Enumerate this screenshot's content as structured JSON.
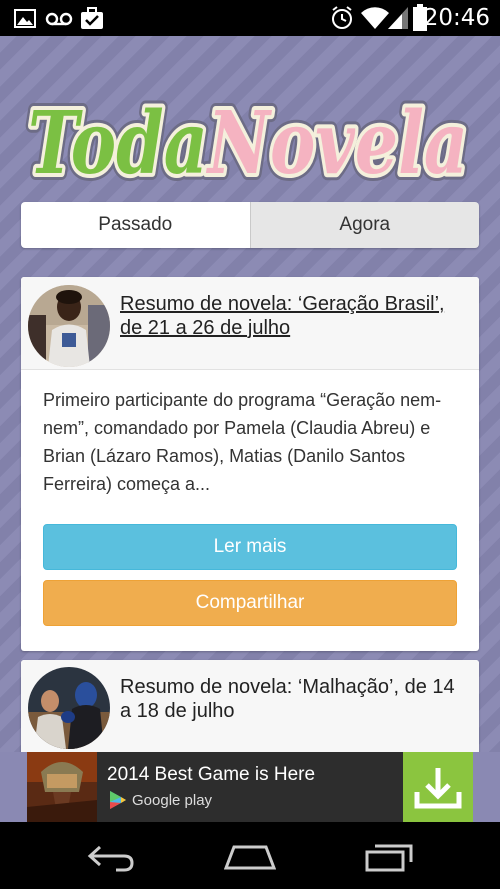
{
  "status_bar": {
    "time": "20:46",
    "icons": [
      "image-icon",
      "voicemail-icon",
      "briefcase-check-icon",
      "alarm-icon",
      "wifi-icon",
      "signal-icon",
      "battery-icon"
    ]
  },
  "logo": {
    "part1": "Toda",
    "part2": "Novela",
    "color1": "#7bc043",
    "color2": "#f7b6c2"
  },
  "tabs": [
    {
      "label": "Passado",
      "active": true
    },
    {
      "label": "Agora",
      "active": false
    }
  ],
  "cards": [
    {
      "title": "Resumo de novela: ‘Geração Brasil’, de 21 a 26 de julho",
      "excerpt": "Primeiro participante do programa “Geração nem-nem”, comandado por Pamela (Claudia Abreu) e Brian (Lázaro Ramos), Matias (Danilo Santos Ferreira) começa a...",
      "read_label": "Ler mais",
      "share_label": "Compartilhar"
    },
    {
      "title": "Resumo de novela: ‘Malhação’, de 14 a 18 de julho"
    }
  ],
  "ad": {
    "title": "2014 Best Game is Here",
    "store": "Google play",
    "accent": "#8bc53f"
  },
  "nav": [
    "back-icon",
    "home-icon",
    "recents-icon"
  ]
}
